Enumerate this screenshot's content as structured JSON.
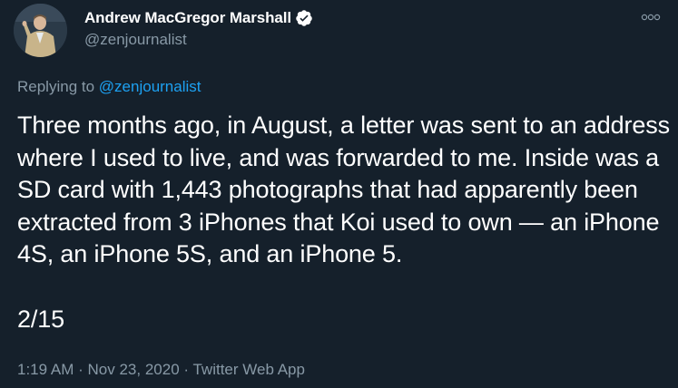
{
  "author": {
    "display_name": "Andrew MacGregor Marshall",
    "handle": "@zenjournalist",
    "verified": true,
    "avatar_icon": "profile-photo"
  },
  "more_icon": "more-options-icon",
  "reply_context": {
    "prefix": "Replying to",
    "mention": "@zenjournalist"
  },
  "tweet": {
    "text": "Three months ago, in August, a letter was sent to an address where I used to live, and was forwarded to me. Inside was a SD card with 1,443 photographs that had apparently been extracted from 3 iPhones that Koi used to own — an iPhone 4S, an iPhone 5S, and an iPhone 5.",
    "thread_counter": "2/15"
  },
  "meta": {
    "time": "1:19 AM",
    "separator_1": "·",
    "date": "Nov 23, 2020",
    "separator_2": "·",
    "source": "Twitter Web App"
  },
  "colors": {
    "background": "#15202b",
    "primary_text": "#ffffff",
    "secondary_text": "#8899a6",
    "link": "#1da1f2",
    "verified_badge": "#ffffff"
  }
}
